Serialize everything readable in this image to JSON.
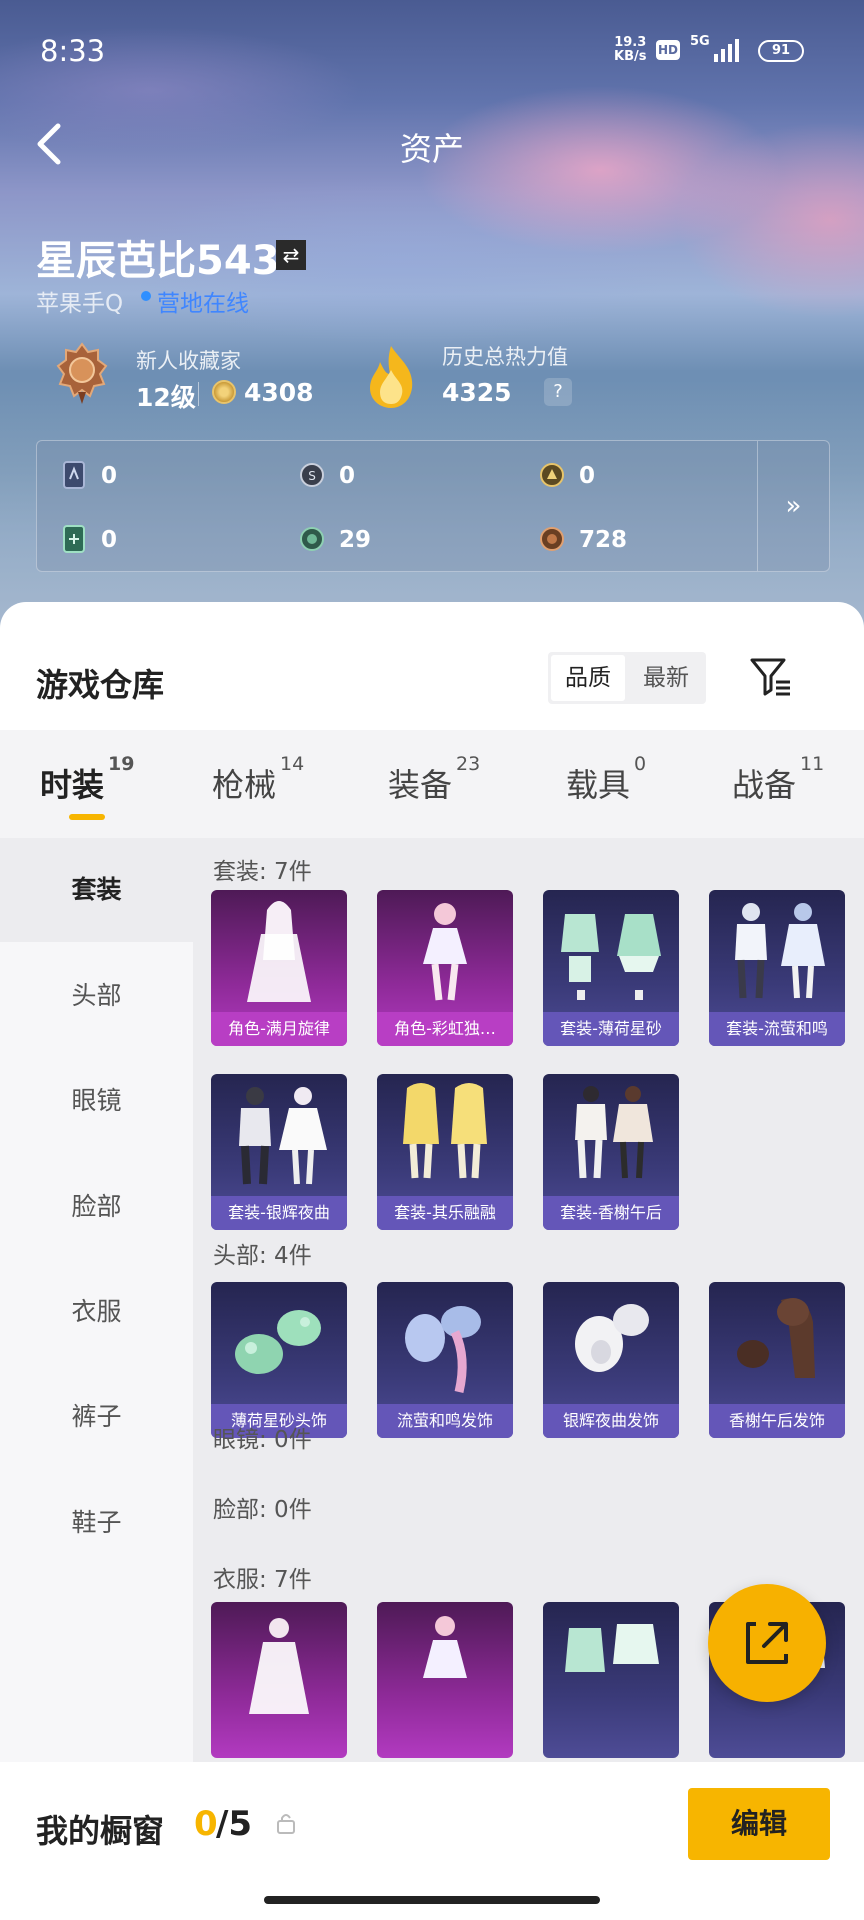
{
  "status_bar": {
    "time": "8:33",
    "net_speed": "19.3",
    "net_unit": "KB/s",
    "hd": "HD",
    "network": "5G",
    "battery": "91"
  },
  "header": {
    "title": "资产"
  },
  "profile": {
    "username": "星辰芭比543",
    "platform": "苹果手Q",
    "online_status": "营地在线",
    "rank_name": "新人收藏家",
    "rank_level": "12级",
    "points": "4308",
    "heat_label": "历史总热力值",
    "heat_value": "4325",
    "help": "?"
  },
  "currencies": [
    {
      "icon": "card-dark-icon",
      "value": "0"
    },
    {
      "icon": "silver-coin-icon",
      "value": "0"
    },
    {
      "icon": "gold-coin-icon",
      "value": "0"
    },
    {
      "icon": "card-green-icon",
      "value": "0"
    },
    {
      "icon": "jade-coin-icon",
      "value": "29"
    },
    {
      "icon": "bronze-coin-icon",
      "value": "728"
    }
  ],
  "currency_more": "»",
  "warehouse": {
    "title": "游戏仓库",
    "sort_options": [
      "品质",
      "最新"
    ],
    "active_sort": "品质"
  },
  "tabs": [
    {
      "label": "时装",
      "count": "19"
    },
    {
      "label": "枪械",
      "count": "14"
    },
    {
      "label": "装备",
      "count": "23"
    },
    {
      "label": "载具",
      "count": "0"
    },
    {
      "label": "战备",
      "count": "11"
    }
  ],
  "sidebar": [
    "套装",
    "头部",
    "眼镜",
    "脸部",
    "衣服",
    "裤子",
    "鞋子"
  ],
  "sections": {
    "sets": {
      "header": "套装: 7件",
      "items": [
        "角色-满月旋律",
        "角色-彩虹独…",
        "套装-薄荷星砂",
        "套装-流萤和鸣",
        "套装-银辉夜曲",
        "套装-其乐融融",
        "套装-香榭午后"
      ]
    },
    "head": {
      "header": "头部: 4件",
      "items": [
        "薄荷星砂头饰",
        "流萤和鸣发饰",
        "银辉夜曲发饰",
        "香榭午后发饰"
      ]
    },
    "glasses": {
      "header": "眼镜: 0件"
    },
    "face": {
      "header": "脸部: 0件"
    },
    "clothes": {
      "header": "衣服: 7件"
    }
  },
  "showcase": {
    "label": "我的橱窗",
    "current": "0",
    "total": "/5"
  },
  "edit_button": "编辑",
  "colors": {
    "accent": "#f7b500",
    "online": "#3f86ff",
    "legendary": "#b83ec4",
    "epic": "#6456b8"
  }
}
